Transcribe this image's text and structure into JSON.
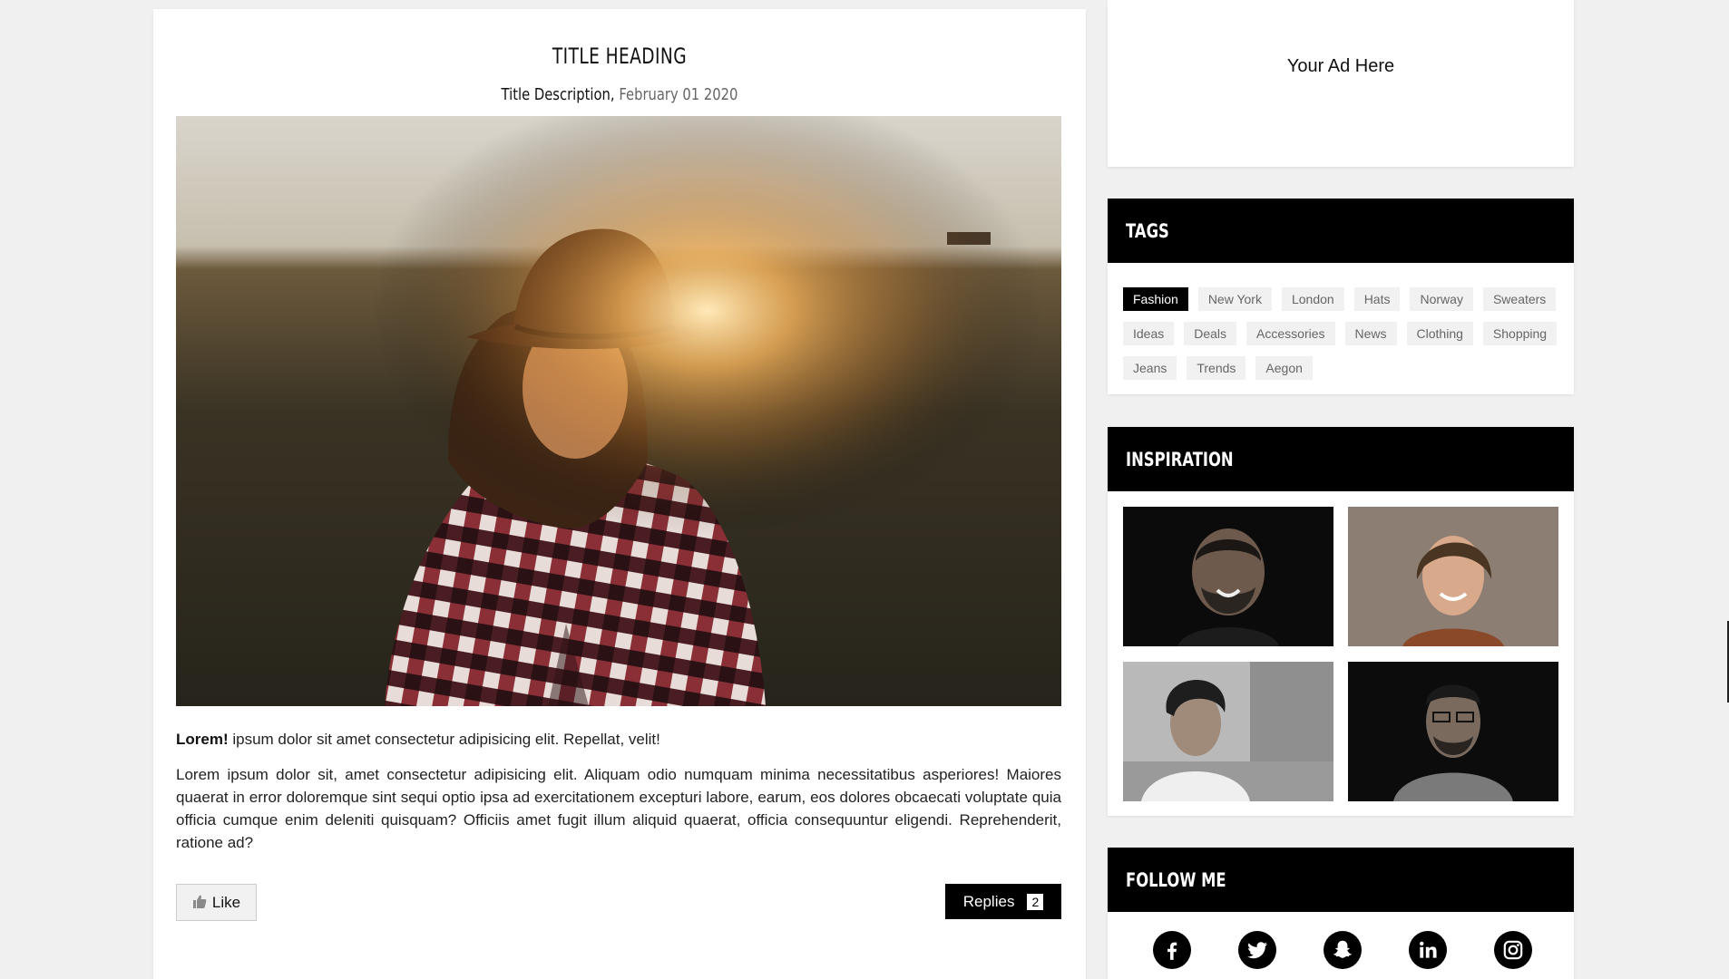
{
  "article": {
    "title": "TITLE HEADING",
    "description": "Title Description,",
    "date": "February 01 2020",
    "intro_bold": "Lorem!",
    "intro_text": " ipsum dolor sit amet consectetur adipisicing elit. Repellat, velit!",
    "body": "Lorem ipsum dolor sit, amet consectetur adipisicing elit. Aliquam odio numquam minima necessitatibus asperiores! Maiores quaerat in error doloremque sint sequi optio ipsa ad exercitationem excepturi labore, earum, eos dolores obcaecati voluptate quia officia cumque enim deleniti quisquam? Officiis amet fugit illum aliquid quaerat, officia consequuntur eligendi. Reprehenderit, ratione ad?",
    "like_label": "Like",
    "replies_label": "Replies",
    "replies_count": "2"
  },
  "sidebar": {
    "ad_text": "Your Ad Here",
    "tags_header": "TAGS",
    "tags": [
      "Fashion",
      "New York",
      "London",
      "Hats",
      "Norway",
      "Sweaters",
      "Ideas",
      "Deals",
      "Accessories",
      "News",
      "Clothing",
      "Shopping",
      "Jeans",
      "Trends",
      "Aegon"
    ],
    "active_tag": "Fashion",
    "inspiration_header": "INSPIRATION",
    "follow_header": "FOLLOW ME",
    "socials": [
      "facebook-icon",
      "twitter-icon",
      "snapchat-icon",
      "linkedin-icon",
      "instagram-icon"
    ]
  },
  "colors": {
    "page_bg": "#f0f0f0",
    "header_bg": "#000000",
    "tag_bg": "#f1f1f1",
    "active_tag_bg": "#000000"
  }
}
